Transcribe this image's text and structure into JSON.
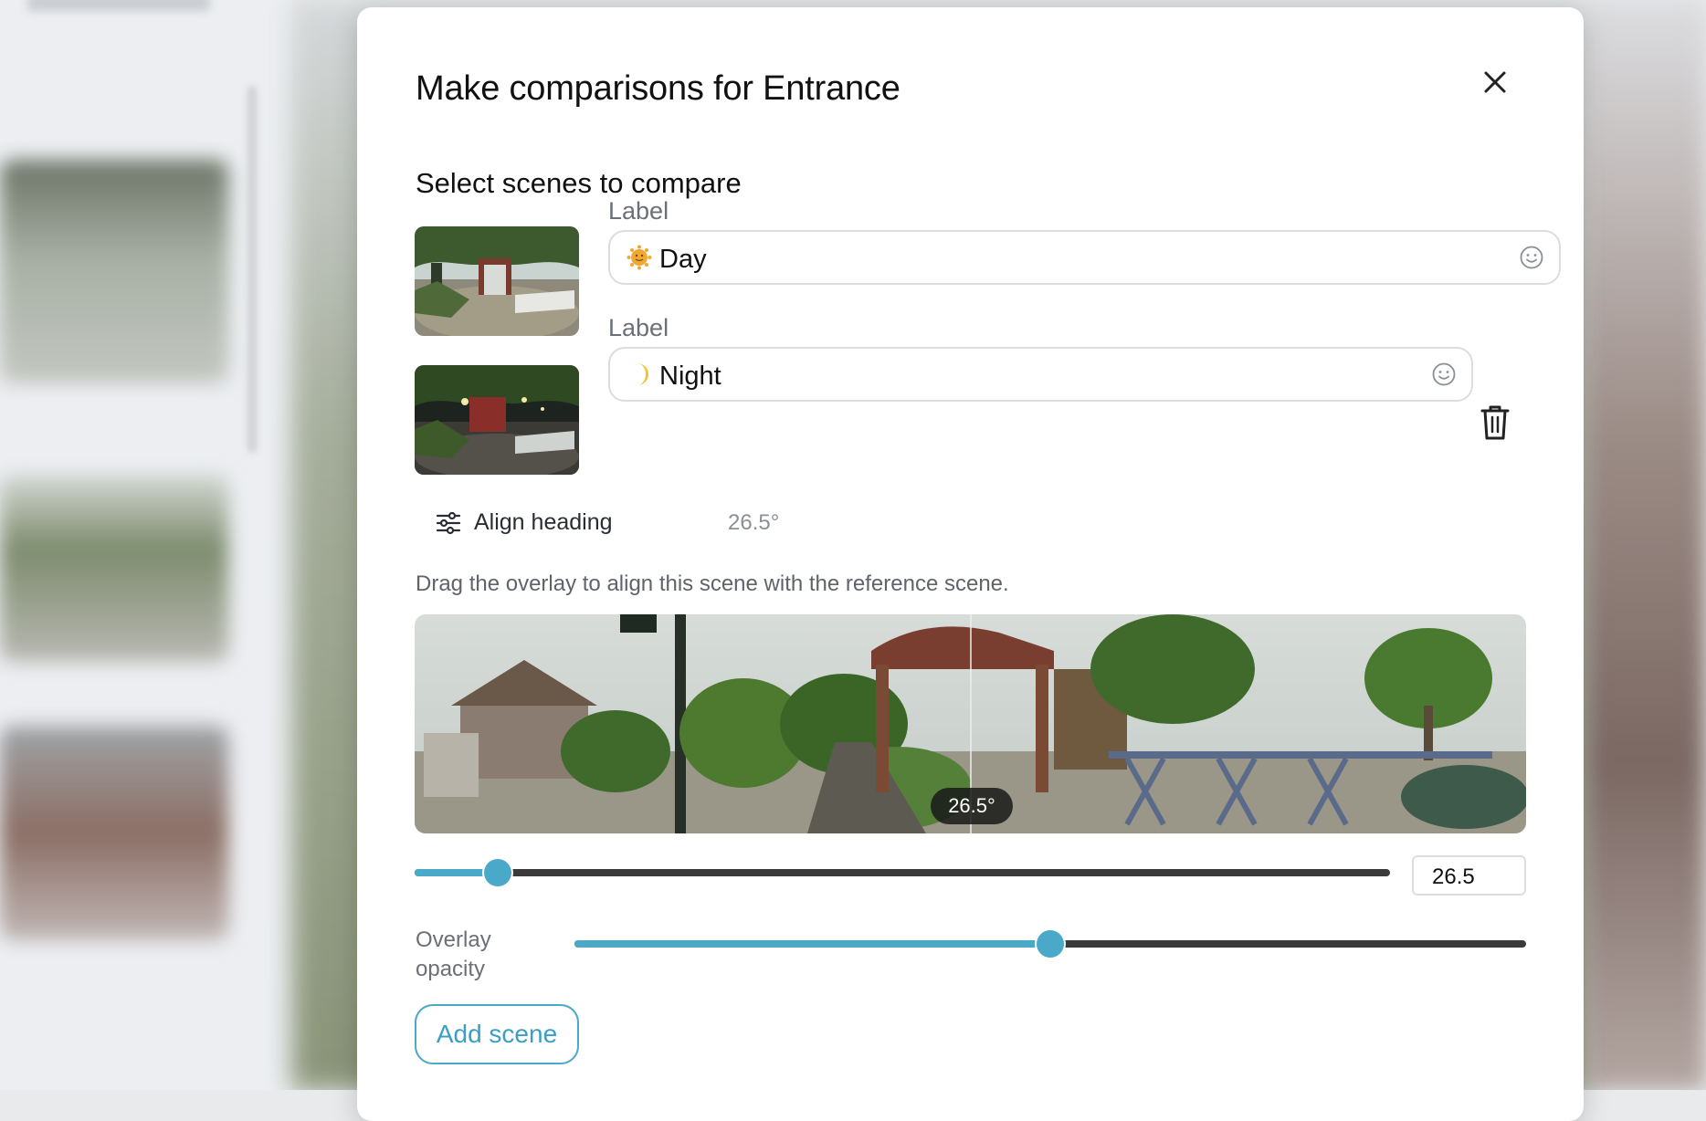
{
  "modal": {
    "title_prefix": "Make comparisons for",
    "title_subject": "Entrance",
    "section_title": "Select scenes to compare",
    "scenes": [
      {
        "label": "Label",
        "emoji": "sun-face-icon",
        "value": "Day",
        "image": "daytime panorama thumbnail"
      },
      {
        "label": "Label",
        "emoji": "crescent-moon-icon",
        "value": "Night",
        "image": "nighttime panorama thumbnail"
      }
    ],
    "align": {
      "label": "Align heading",
      "value": "26.5°",
      "hint": "Drag the overlay to align this scene with the reference scene.",
      "badge": "26.5°",
      "slider_fraction": 0.085,
      "input_value": "26.5"
    },
    "opacity": {
      "label_line1": "Overlay",
      "label_line2": "opacity",
      "fraction": 0.5
    },
    "add_scene_label": "Add scene"
  },
  "colors": {
    "accent": "#4aa8c8",
    "track": "#3a3a3a",
    "border": "#dcdde0"
  }
}
